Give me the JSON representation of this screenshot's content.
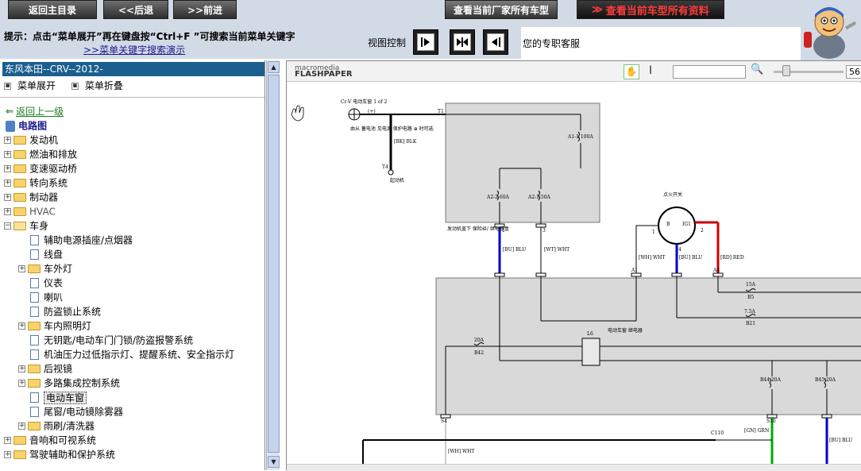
{
  "nav": {
    "home": "返回主目录",
    "back": "<<后退",
    "forward": ">>前进",
    "models": "查看当前厂家所有车型",
    "current_data": "查看当前车型所有资料",
    "current_arrow": "≫"
  },
  "hint": {
    "text": "提示：点击“菜单展开”再在键盘按“Ctrl+F ”可搜索当前菜单关键字",
    "link": ">>菜单关键字搜索演示",
    "view_control": "视图控制",
    "service": "您的专职客服"
  },
  "sidebar": {
    "car_title": "东风本田--CRV--2012-",
    "expand_label": "菜单展开",
    "collapse_label": "菜单折叠",
    "back_up": "返回上一级",
    "root": "电路图",
    "items": [
      {
        "label": "发动机"
      },
      {
        "label": "燃油和排放"
      },
      {
        "label": "变速驱动桥"
      },
      {
        "label": "转向系统"
      },
      {
        "label": "制动器"
      },
      {
        "label": "HVAC"
      },
      {
        "label": "车身"
      },
      {
        "label": "辅助电源插座/点烟器"
      },
      {
        "label": "线盘"
      },
      {
        "label": "车外灯"
      },
      {
        "label": "仪表"
      },
      {
        "label": "喇叭"
      },
      {
        "label": "防盗锁止系统"
      },
      {
        "label": "车内照明灯"
      },
      {
        "label": "无钥匙/电动车门门锁/防盗报警系统"
      },
      {
        "label": "机油压力过低指示灯、提醒系统、安全指示灯"
      },
      {
        "label": "后视镜"
      },
      {
        "label": "多路集成控制系统"
      },
      {
        "label": "电动车窗"
      },
      {
        "label": "尾窗/电动镜除雾器"
      },
      {
        "label": "雨刷/清洗器"
      },
      {
        "label": "音响和可视系统"
      },
      {
        "label": "驾驶辅助和保护系统"
      }
    ]
  },
  "viewer": {
    "logo_small": "macromedia",
    "logo_big": "FLASHPAPER",
    "zoom": "56"
  },
  "diagram": {
    "title": "Cr-V 电动车窗 1 of 2",
    "plus": "(+)",
    "note": "由从 蓄电池 见电源 保护电路 ⊕ 时可选",
    "t1": "T1",
    "wire_bk": "[BK] BLK",
    "t4": "T4",
    "starter": "起动机",
    "fuse_a1": "A1-1 100A",
    "fuse_a2_2": "A2-2 60A",
    "fuse_a2_1": "A2-1 50A",
    "underhood": "发动机盖下 保险丝/ 继电器盒",
    "ign_label": "点火开关",
    "ign_b": "B",
    "ign_ig1": "IG1",
    "ign_1": "1",
    "ign_2": "2",
    "ign_3": "3",
    "ign_4": "4",
    "wire_blu1": "[BU] BLU",
    "wire_wht1": "[WT] WHT",
    "wire_wht2": "[WH] WHT",
    "wire_blu2": "[BU] BLU",
    "wire_red": "[RD] RED",
    "conn_1": "1",
    "conn_3": "3",
    "conn_a1": "A1",
    "conn_a4": "A4",
    "fuse_15a": "15A",
    "fuse_b5": "B5",
    "fuse_75a": "7.5A",
    "fuse_b21": "B21",
    "relay_l6": "L6",
    "relay_label": "电动车窗 继电器",
    "fuse_20a": "20A",
    "fuse_b42": "B42",
    "fuse_b44": "B44 20A",
    "fuse_b45": "B45 20A",
    "conn_s4": "S4",
    "conn_s10": "S10",
    "conn_c110": "C110",
    "wire_grn": "[GN] GRN",
    "wire_blu3": "[BU] BLU",
    "wire_wht3": "[WH] WHT"
  }
}
